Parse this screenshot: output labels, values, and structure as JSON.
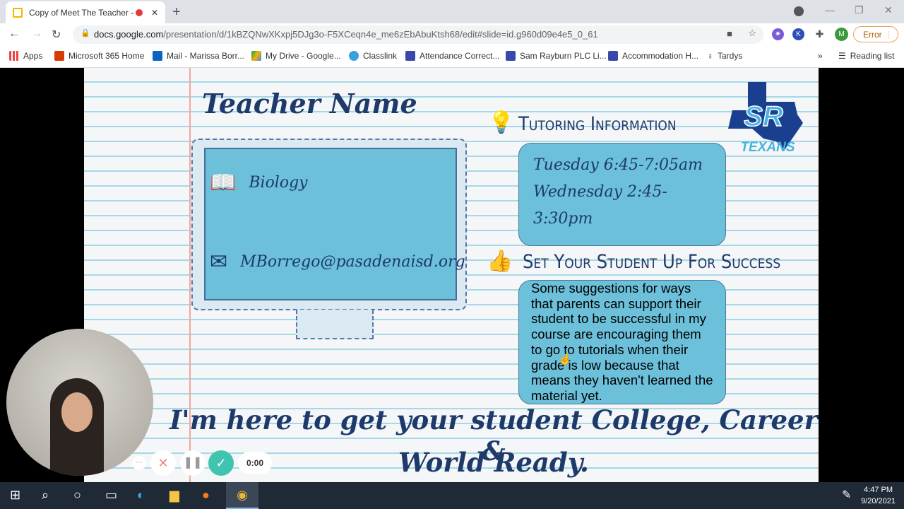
{
  "browser": {
    "tab_title": "Copy of Meet The Teacher -",
    "url_host": "docs.google.com",
    "url_path": "/presentation/d/1kBZQNwXKxpj5DJg3o-F5XCeqn4e_me6zEbAbuKtsh68/edit#slide=id.g960d09e4e5_0_61",
    "profile_initial": "M",
    "error_label": "Error",
    "bookmarks": [
      "Apps",
      "Microsoft 365 Home",
      "Mail - Marissa Borr...",
      "My Drive - Google...",
      "Classlink",
      "Attendance Correct...",
      "Sam Rayburn PLC Li...",
      "Accommodation H...",
      "Tardys"
    ],
    "reading_list": "Reading list"
  },
  "slide": {
    "title": "Teacher Name",
    "subject": "Biology",
    "email": "MBorrego@pasadenaisd.org",
    "tutoring_heading": "Tutoring Information",
    "tutoring_lines": [
      "Tuesday  6:45-7:05am",
      "Wednesday 2:45-3:30pm"
    ],
    "success_heading": "Set Your Student Up For Success",
    "success_text": "Some suggestions for ways that parents can support their student to be successful in my course are encouraging them to go to tutorials when their grade is low because that means they haven't learned the material yet.",
    "logo_text": "SR",
    "logo_sub": "TEXANS",
    "closing_line1": "I'm here to get your student College, Career &",
    "closing_line2": "World Ready."
  },
  "recorder": {
    "timer": "0:00"
  },
  "taskbar": {
    "time": "4:47 PM",
    "date": "9/20/2021"
  }
}
